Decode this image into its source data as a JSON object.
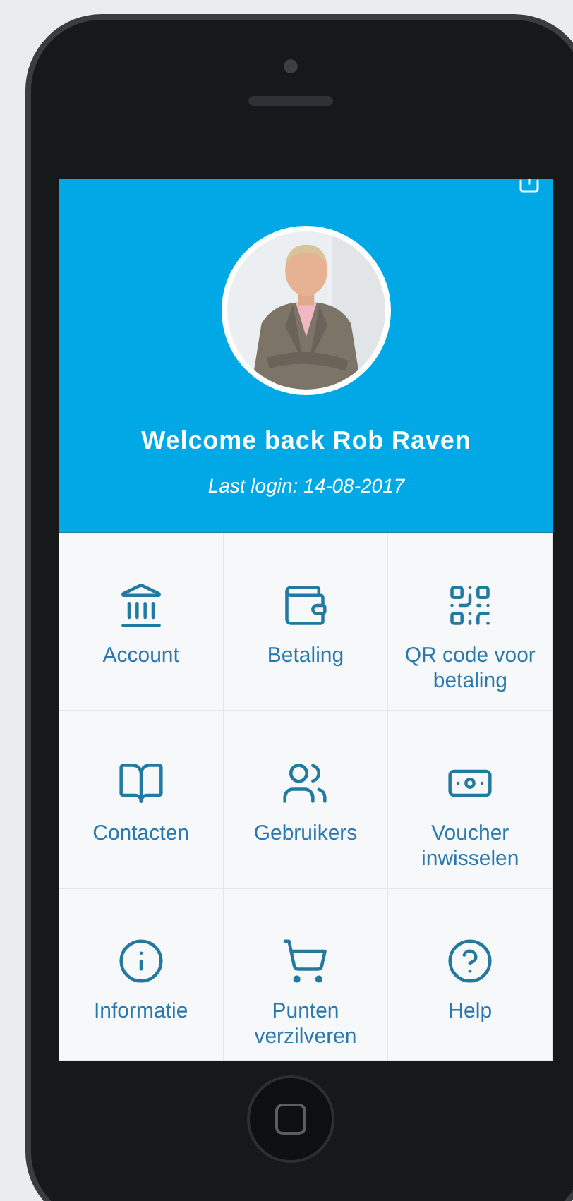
{
  "header": {
    "title": "Welcome back Rob Raven",
    "subtitle": "Last login: 14-08-2017"
  },
  "tiles": [
    {
      "label": "Account"
    },
    {
      "label": "Betaling"
    },
    {
      "label": "QR code voor betaling"
    },
    {
      "label": "Contacten"
    },
    {
      "label": "Gebruikers"
    },
    {
      "label": "Voucher inwisselen"
    },
    {
      "label": "Informatie"
    },
    {
      "label": "Punten verzilveren"
    },
    {
      "label": "Help"
    }
  ]
}
